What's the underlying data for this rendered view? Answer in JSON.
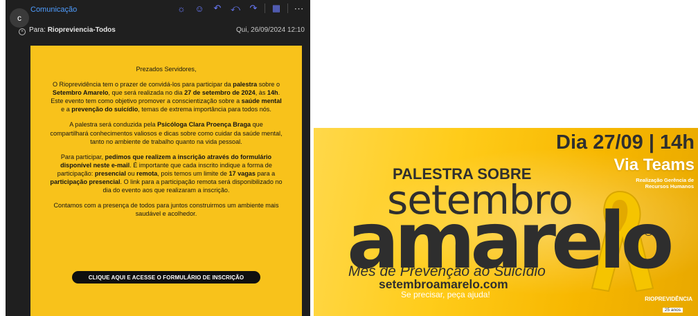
{
  "email": {
    "avatar_letter": "c",
    "sender": "Comunicação",
    "to_label": "Para:",
    "to_value": "Riopreviencia-Todos",
    "date": "Qui, 26/09/2024 12:10",
    "toolbar": {
      "icons": [
        "sun-icon",
        "emoji-icon",
        "reply-icon",
        "reply-all-icon",
        "forward-icon",
        "apps-icon",
        "more-icon"
      ]
    },
    "body": {
      "greeting": "Prezados Servidores,",
      "p1": {
        "t1": "O Rioprevidência tem o prazer de convidá-los para participar da ",
        "b1": "palestra",
        "t2": " sobre o ",
        "b2": "Setembro Amarelo",
        "t3": ", que será realizada no dia ",
        "b3": "27 de setembro de 2024",
        "t4": ", às ",
        "b4": "14h",
        "t5": ". Este evento tem como objetivo promover a conscientização sobre a ",
        "b5": "saúde mental",
        "t6": " e a ",
        "b6": "prevenção do suicídio",
        "t7": ", temas de extrema importância para todos nós."
      },
      "p2": {
        "t1": "A palestra será conduzida pela ",
        "b1": "Psicóloga Clara Proença Braga",
        "t2": " que compartilhará conhecimentos valiosos e dicas sobre como cuidar da saúde mental, tanto no ambiente de trabalho quanto na vida pessoal."
      },
      "p3": {
        "t1": "Para participar, ",
        "b1": "pedimos que realizem a inscrição através do formulário disponível neste e-mail",
        "t2": ". É importante que cada inscrito indique a forma de participação: ",
        "b2": "presencial",
        "t3": " ou ",
        "b3": "remota",
        "t4": ", pois temos um limite de ",
        "b4": "17 vagas",
        "t5": " para a ",
        "b5": "participação presencial",
        "t6": ". O link para a participação remota será disponibilizado no dia do evento aos que realizaram a inscrição."
      },
      "p4": "Contamos com a presença de todos para juntos construirmos um ambiente mais saudável e acolhedor.",
      "cta": "CLIQUE AQUI E ACESSE O FORMULÁRIO DE INSCRIÇÃO"
    },
    "colors": {
      "card": "#f8c21b",
      "sender": "#4f9dff"
    }
  },
  "banner": {
    "date_line": "Dia 27/09 | 14h",
    "platform": "Via Teams",
    "credit": "Realização Gerência de Recursos Humanos",
    "heading": "PALESTRA SOBRE",
    "word1": "setembro",
    "word2": "amarelo",
    "registered": "®",
    "subtitle": "Mês de Prevenção ao Suicídio",
    "site": "setembroamarelo.com",
    "help": "Se precisar, peça ajuda!",
    "org": "RIOPREVIDÊNCIA",
    "anniversary": "25 anos"
  }
}
